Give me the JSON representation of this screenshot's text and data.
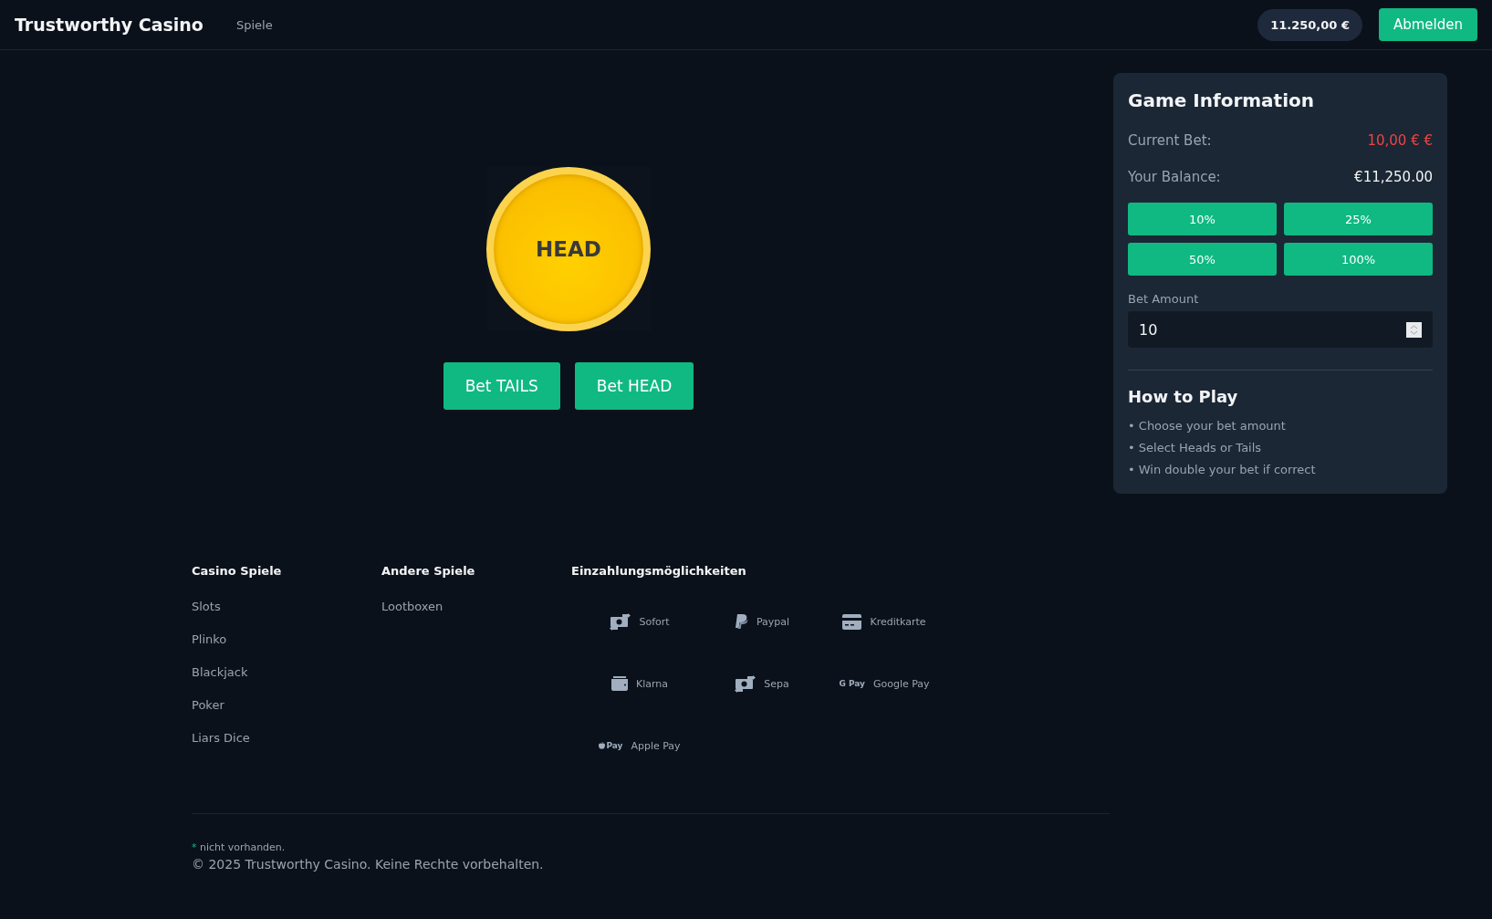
{
  "header": {
    "logo": "Trustworthy Casino",
    "nav": [
      {
        "label": "Spiele"
      }
    ],
    "balance": "11.250,00 €",
    "logout": "Abmelden"
  },
  "coin": {
    "face": "HEAD"
  },
  "bet_buttons": [
    "Bet TAILS",
    "Bet HEAD"
  ],
  "game_info": {
    "title": "Game Information",
    "rows": [
      {
        "label": "Current Bet:",
        "value": "10,00 € €",
        "kind": "bet"
      },
      {
        "label": "Your Balance:",
        "value": "€11,250.00",
        "kind": "balance"
      }
    ],
    "percent_buttons": [
      "10%",
      "25%",
      "50%",
      "100%"
    ],
    "bet_amount": {
      "label": "Bet Amount",
      "value": "10"
    },
    "how_to_title": "How to Play",
    "how_to": [
      "• Choose your bet amount",
      "• Select Heads or Tails",
      "• Win double your bet if correct"
    ]
  },
  "footer": {
    "columns": [
      {
        "title": "Casino Spiele",
        "links": [
          "Slots",
          "Plinko",
          "Blackjack",
          "Poker",
          "Liars Dice"
        ]
      },
      {
        "title": "Andere Spiele",
        "links": [
          "Lootboxen"
        ]
      }
    ],
    "payments_title": "Einzahlungsmöglichkeiten",
    "payments": [
      {
        "label": "Sofort",
        "kind": "transfer"
      },
      {
        "label": "Paypal",
        "kind": "paypal"
      },
      {
        "label": "Kreditkarte",
        "kind": "card"
      },
      {
        "label": "Klarna",
        "kind": "wallet"
      },
      {
        "label": "Sepa",
        "kind": "transfer"
      },
      {
        "label": "Google Pay",
        "kind": "gpay",
        "logo_text": "G Pay"
      },
      {
        "label": "Apple Pay",
        "kind": "applepay",
        "logo_text": "Pay"
      }
    ],
    "note_mark": "*",
    "note": "nicht vorhanden.",
    "copyright": "© 2025 Trustworthy Casino. Keine Rechte vorbehalten."
  }
}
